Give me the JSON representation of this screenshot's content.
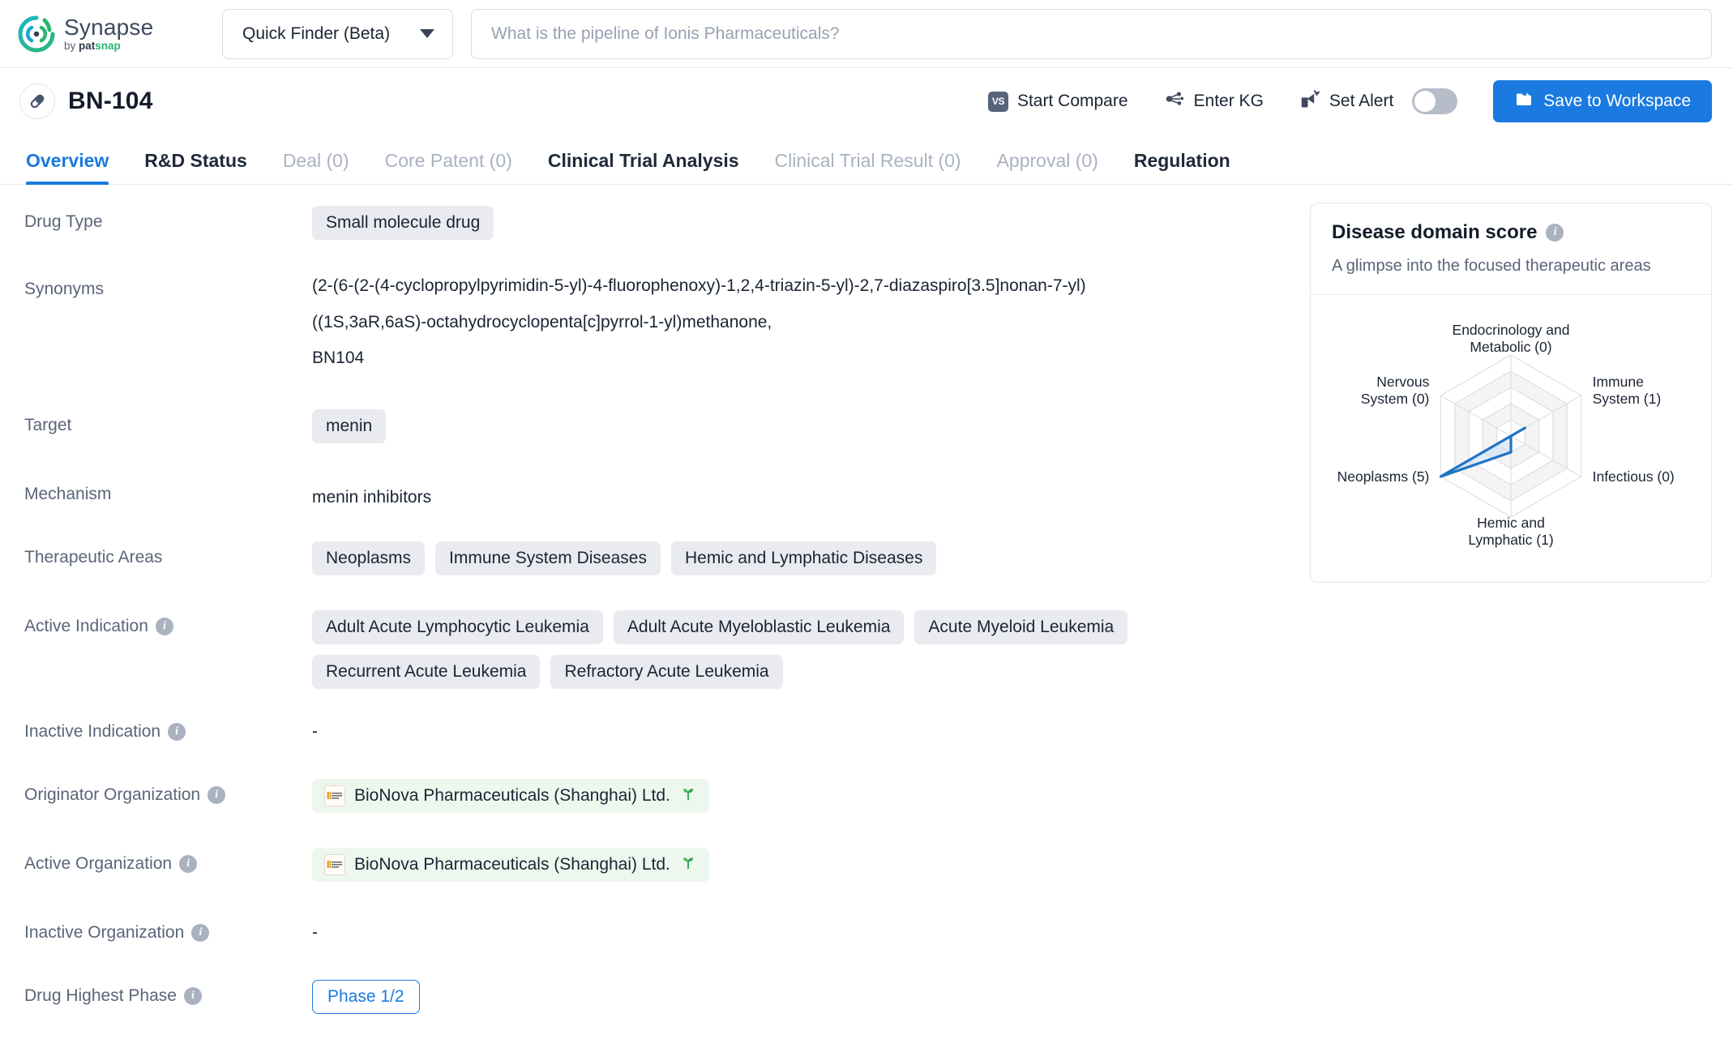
{
  "brand": {
    "name": "Synapse",
    "by": "by ",
    "pat": "pat",
    "snap": "snap",
    "logo_icon": "synapse-logo-icon"
  },
  "topbar": {
    "finder": {
      "label": "Quick Finder (Beta)",
      "caret_icon": "chevron-down-icon"
    },
    "search": {
      "value": "",
      "placeholder": "What is the pipeline of Ionis Pharmaceuticals?"
    }
  },
  "drug_header": {
    "pill_icon": "capsule-icon",
    "title": "BN-104",
    "actions": [
      {
        "label": "Start Compare",
        "icon": "vs-icon",
        "icon_text": "VS"
      },
      {
        "label": "Enter KG",
        "icon": "knowledge-graph-icon"
      },
      {
        "label": "Set Alert",
        "icon": "alert-bell-icon"
      }
    ],
    "toggle_state": "off",
    "save_button": {
      "label": "Save to Workspace",
      "icon": "folder-icon",
      "color": "#1a7ae0"
    }
  },
  "tabs": [
    {
      "label": "Overview",
      "state": "active"
    },
    {
      "label": "R&D Status",
      "state": "normal"
    },
    {
      "label": "Deal (0)",
      "state": "disabled"
    },
    {
      "label": "Core Patent (0)",
      "state": "disabled"
    },
    {
      "label": "Clinical Trial Analysis",
      "state": "normal"
    },
    {
      "label": "Clinical Trial Result (0)",
      "state": "disabled"
    },
    {
      "label": "Approval (0)",
      "state": "disabled"
    },
    {
      "label": "Regulation",
      "state": "normal"
    }
  ],
  "fields": {
    "drug_type": {
      "label": "Drug Type",
      "values": [
        "Small molecule drug"
      ]
    },
    "synonyms": {
      "label": "Synonyms",
      "lines": [
        "(2-(6-(2-(4-cyclopropylpyrimidin-5-yl)-4-fluorophenoxy)-1,2,4-triazin-5-yl)-2,7-diazaspiro[3.5]nonan-7-yl)",
        "((1S,3aR,6aS)-octahydrocyclopenta[c]pyrrol-1-yl)methanone,",
        "BN104"
      ]
    },
    "target": {
      "label": "Target",
      "values": [
        "menin"
      ]
    },
    "mechanism": {
      "label": "Mechanism",
      "value": "menin inhibitors"
    },
    "therapeutic_areas": {
      "label": "Therapeutic Areas",
      "values": [
        "Neoplasms",
        "Immune System Diseases",
        "Hemic and Lymphatic Diseases"
      ]
    },
    "active_indication": {
      "label": "Active Indication",
      "info_icon": "info-icon",
      "values": [
        "Adult Acute Lymphocytic Leukemia",
        "Adult Acute Myeloblastic Leukemia",
        "Acute Myeloid Leukemia",
        "Recurrent Acute Leukemia",
        "Refractory Acute Leukemia"
      ]
    },
    "inactive_indication": {
      "label": "Inactive Indication",
      "info_icon": "info-icon",
      "value": "-"
    },
    "originator_organization": {
      "label": "Originator Organization",
      "info_icon": "info-icon",
      "values": [
        {
          "name": "BioNova Pharmaceuticals (Shanghai) Ltd.",
          "logo_icon": "bionova-logo-icon",
          "badge_icon": "sprout-icon"
        }
      ]
    },
    "active_organization": {
      "label": "Active Organization",
      "info_icon": "info-icon",
      "values": [
        {
          "name": "BioNova Pharmaceuticals (Shanghai) Ltd.",
          "logo_icon": "bionova-logo-icon",
          "badge_icon": "sprout-icon"
        }
      ]
    },
    "inactive_organization": {
      "label": "Inactive Organization",
      "info_icon": "info-icon",
      "value": "-"
    },
    "drug_highest_phase": {
      "label": "Drug Highest Phase",
      "info_icon": "info-icon",
      "value": "Phase 1/2"
    }
  },
  "side_card": {
    "title": "Disease domain score",
    "info_icon": "info-icon",
    "subtitle": "A glimpse into the focused therapeutic areas"
  },
  "chart_data": {
    "type": "radar",
    "title": "Disease domain score",
    "subtitle": "A glimpse into the focused therapeutic areas",
    "categories": [
      "Endocrinology and Metabolic",
      "Immune System",
      "Infectious",
      "Hemic and Lymphatic",
      "Neoplasms",
      "Nervous System"
    ],
    "tick_labels": [
      "Endocrinology and Metabolic (0)",
      "Immune System (1)",
      "Infectious (0)",
      "Hemic and Lymphatic (1)",
      "Neoplasms (5)",
      "Nervous System (0)"
    ],
    "values": [
      0,
      1,
      0,
      1,
      5,
      0
    ],
    "rlim": [
      0,
      5
    ],
    "rings": 5,
    "grid": true,
    "legend": "none",
    "series_color": "#1f74c4",
    "fill_color": "#c8ddf2"
  }
}
